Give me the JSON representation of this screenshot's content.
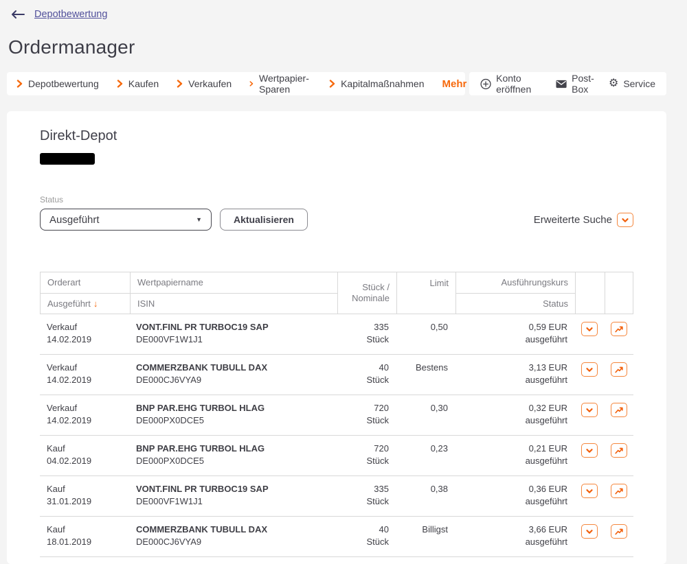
{
  "page": {
    "back_link": "Depotbewertung",
    "title": "Ordermanager"
  },
  "nav": {
    "items": [
      "Depotbewertung",
      "Kaufen",
      "Verkaufen",
      "Wertpapier-Sparen",
      "Kapitalmaßnahmen"
    ],
    "more_label": "Mehr",
    "secondary": [
      {
        "icon": "circle-plus-icon",
        "label": "Konto eröffnen"
      },
      {
        "icon": "envelope-icon",
        "label": "Post-Box"
      },
      {
        "icon": "gear-icon",
        "label": "Service"
      }
    ]
  },
  "depot": {
    "name": "Direkt-Depot"
  },
  "filters": {
    "status_label": "Status",
    "status_value": "Ausgeführt",
    "refresh_label": "Aktualisieren",
    "advanced_search_label": "Erweiterte Suche"
  },
  "table": {
    "headers": {
      "col1_top": "Orderart",
      "col1_bottom": "Ausgeführt",
      "sort_arrow": "↓",
      "col2_top": "Wertpapiername",
      "col2_bottom": "ISIN",
      "col3_line1": "Stück /",
      "col3_line2": "Nominale",
      "col4": "Limit",
      "col5_top": "Ausführungskurs",
      "col5_bottom": "Status"
    },
    "rows": [
      {
        "type": "Verkauf",
        "date": "14.02.2019",
        "name": "VONT.FINL PR TURBOC19 SAP",
        "isin": "DE000VF1W1J1",
        "qty": "335",
        "unit": "Stück",
        "limit": "0,50",
        "price": "0,59 EUR",
        "status": "ausgeführt"
      },
      {
        "type": "Verkauf",
        "date": "14.02.2019",
        "name": "COMMERZBANK TUBULL DAX",
        "isin": "DE000CJ6VYA9",
        "qty": "40",
        "unit": "Stück",
        "limit": "Bestens",
        "price": "3,13 EUR",
        "status": "ausgeführt"
      },
      {
        "type": "Verkauf",
        "date": "14.02.2019",
        "name": "BNP PAR.EHG TURBOL HLAG",
        "isin": "DE000PX0DCE5",
        "qty": "720",
        "unit": "Stück",
        "limit": "0,30",
        "price": "0,32 EUR",
        "status": "ausgeführt"
      },
      {
        "type": "Kauf",
        "date": "04.02.2019",
        "name": "BNP PAR.EHG TURBOL HLAG",
        "isin": "DE000PX0DCE5",
        "qty": "720",
        "unit": "Stück",
        "limit": "0,23",
        "price": "0,21 EUR",
        "status": "ausgeführt"
      },
      {
        "type": "Kauf",
        "date": "31.01.2019",
        "name": "VONT.FINL PR TURBOC19 SAP",
        "isin": "DE000VF1W1J1",
        "qty": "335",
        "unit": "Stück",
        "limit": "0,38",
        "price": "0,36 EUR",
        "status": "ausgeführt"
      },
      {
        "type": "Kauf",
        "date": "18.01.2019",
        "name": "COMMERZBANK TUBULL DAX",
        "isin": "DE000CJ6VYA9",
        "qty": "40",
        "unit": "Stück",
        "limit": "Billigst",
        "price": "3,66 EUR",
        "status": "ausgeführt"
      }
    ]
  },
  "colors": {
    "accent_orange": "#f6690d",
    "link_indigo": "#52519b",
    "text_dark": "#3f3f46",
    "header_gray": "#7a7a80",
    "border_gray": "#d8d8d8"
  }
}
